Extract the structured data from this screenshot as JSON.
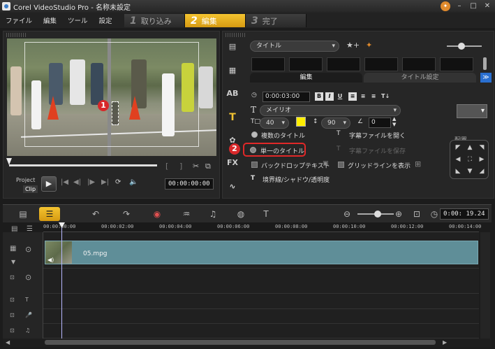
{
  "window": {
    "title": "Corel VideoStudio Pro - 名称未設定"
  },
  "menu": [
    "ファイル",
    "編集",
    "ツール",
    "設定"
  ],
  "steps": [
    {
      "num": "1",
      "label": "取り込み"
    },
    {
      "num": "2",
      "label": "編集"
    },
    {
      "num": "3",
      "label": "完了"
    }
  ],
  "preview": {
    "project_label": "Project",
    "clip_label": "Clip",
    "timecode": "00:00:00:00",
    "callout_1": "1"
  },
  "options": {
    "category": "タイトル",
    "tabs": [
      "編集",
      "タイトル設定"
    ],
    "duration": "0:00:03:00",
    "font": "メイリオ",
    "font_size": "40",
    "line_spacing": "90",
    "angle": "0",
    "multi_title": "複数のタイトル",
    "single_title": "単一のタイトル",
    "open_subtitle": "字幕ファイルを開く",
    "save_subtitle": "字幕ファイルを保存",
    "backdrop_text": "バックドロップテキスト",
    "show_grid": "グリッドラインを表示",
    "border_shadow": "境界線/シャドウ/透明度",
    "align_label": "配置",
    "callout_2": "2",
    "color": "#ffee00"
  },
  "timeline": {
    "timecode": "0:00: 19.24",
    "ruler_ticks": [
      "00:00:00:00",
      "00:00:02:00",
      "00:00:04:00",
      "00:00:06:00",
      "00:00:08:00",
      "00:00:10:00",
      "00:00:12:00",
      "00:00:14:00"
    ],
    "clip_name": "05.mpg"
  }
}
